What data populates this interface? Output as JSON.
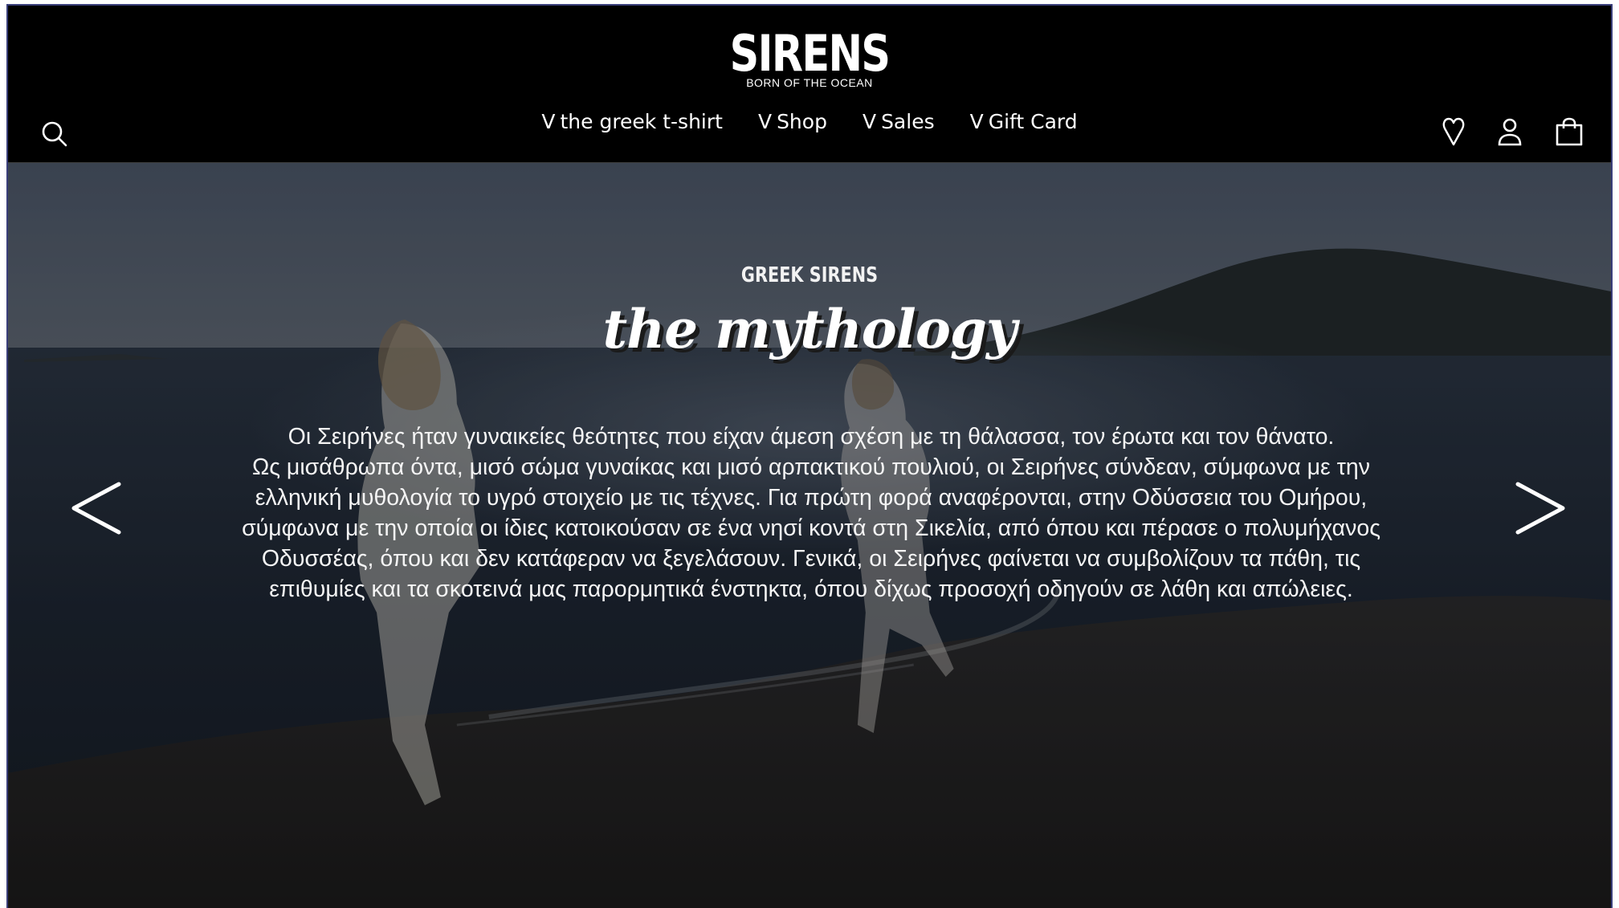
{
  "brand": {
    "name": "SIRENS",
    "tagline": "BORN OF THE OCEAN"
  },
  "nav": {
    "chevron": "V",
    "items": [
      {
        "label": "the greek t-shirt"
      },
      {
        "label": "Shop"
      },
      {
        "label": "Sales"
      },
      {
        "label": "Gift Card"
      }
    ]
  },
  "header_icons": {
    "search": "search-icon",
    "wishlist": "heart-icon",
    "account": "user-icon",
    "cart": "shopping-bag-icon"
  },
  "hero": {
    "eyebrow": "GREEK SIRENS",
    "title": "the mythology",
    "lines": [
      "Οι Σειρήνες ήταν γυναικείες θεότητες που είχαν άμεση σχέση με τη θάλασσα, τον έρωτα και τον θάνατο.",
      "Ως μισάθρωπα όντα, μισό σώμα γυναίκας και μισό αρπακτικού πουλιού, οι Σειρήνες σύνδεαν, σύμφωνα με την",
      "ελληνική μυθολογία το υγρό στοιχείο με τις τέχνες. Για πρώτη φορά αναφέρονται, στην Οδύσσεια του Ομήρου,",
      "σύμφωνα με την οποία οι ίδιες κατοικούσαν σε ένα νησί κοντά στη Σικελία, από όπου και πέρασε ο πολυμήχανος",
      "Οδυσσέας, όπου και δεν κατάφεραν να ξεγελάσουν. Γενικά, οι Σειρήνες φαίνεται να συμβολίζουν τα πάθη, τις",
      "επιθυμίες και τα σκοτεινά μας παρορμητικά ένστηκτα, όπου δίχως προσοχή οδηγούν σε λάθη και απώλειες."
    ],
    "prev_icon": "chevron-left-icon",
    "next_icon": "chevron-right-icon"
  },
  "colors": {
    "header_bg": "#000000",
    "text": "#ffffff",
    "frame_border": "#3a3f7a"
  }
}
